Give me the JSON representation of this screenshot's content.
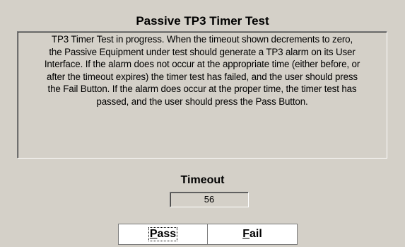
{
  "window": {
    "title": "Passive TP3 Timer Test"
  },
  "description": {
    "text": "TP3 Timer Test in progress.  When the timeout shown decrements to zero,\nthe Passive Equipment under test should generate a TP3 alarm on its User\nInterface.  If the alarm does not occur at the appropriate time (either before, or\nafter the timeout expires) the timer test has failed, and the user should press\nthe Fail Button.  If the alarm does occur at the proper time, the timer test has\npassed, and the user should press the Pass Button."
  },
  "timeout": {
    "label": "Timeout",
    "value": "56"
  },
  "buttons": {
    "pass": {
      "accel": "P",
      "rest": "ass"
    },
    "fail": {
      "accel": "F",
      "rest": "ail"
    }
  },
  "colors": {
    "background": "#d4d0c8",
    "button_face": "#ffffff"
  }
}
